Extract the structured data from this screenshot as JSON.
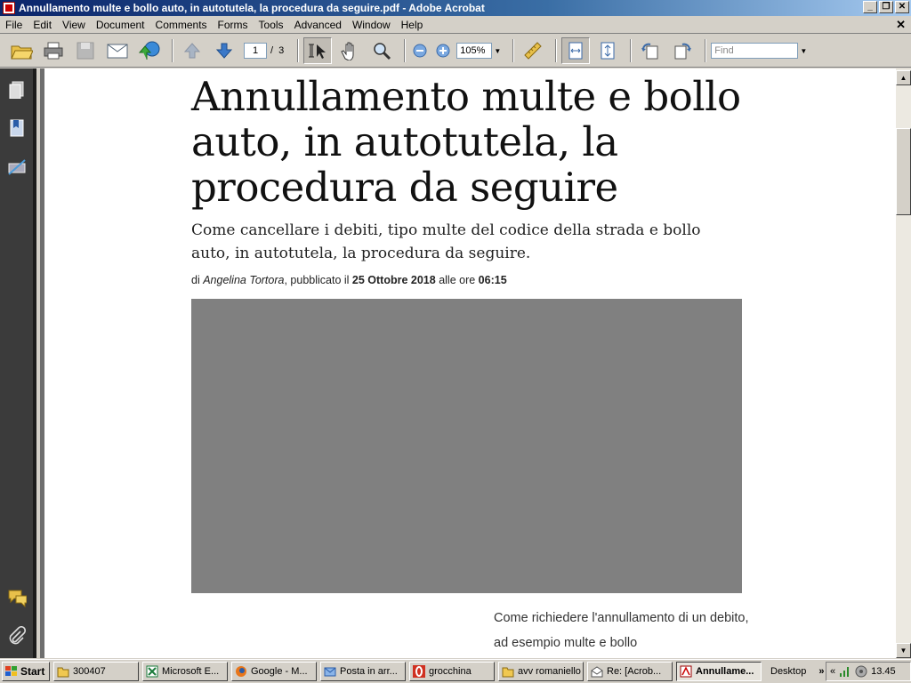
{
  "window": {
    "title": "Annullamento multe e bollo auto, in autotutela, la procedura da seguire.pdf - Adobe Acrobat",
    "buttons": [
      "_",
      "❐",
      "✕"
    ]
  },
  "menubar": {
    "items": [
      "File",
      "Edit",
      "View",
      "Document",
      "Comments",
      "Forms",
      "Tools",
      "Advanced",
      "Window",
      "Help"
    ],
    "close": "✕"
  },
  "toolbar": {
    "page_current": "1",
    "page_total": "/  3",
    "zoom": "105%",
    "find_placeholder": "Find",
    "icons": [
      "open-icon",
      "print-icon",
      "save-icon",
      "email-icon",
      "organizer-icon",
      "previous-page-icon",
      "next-page-icon",
      "select-tool-icon",
      "hand-tool-icon",
      "zoom-tool-icon",
      "zoom-out-icon",
      "zoom-in-icon",
      "measure-icon",
      "fit-width-icon",
      "fit-page-icon",
      "rotate-left-icon",
      "rotate-right-icon"
    ]
  },
  "navpane": {
    "icons": [
      "pages-icon",
      "bookmarks-icon",
      "signatures-icon",
      "comments-icon",
      "attachments-icon"
    ]
  },
  "document": {
    "headline": "Annullamento multe e bollo auto, in autotutela, la procedura da seguire",
    "subtitle": "Come cancellare i debiti, tipo multe del codice della strada e bollo auto, in autotutela, la procedura da seguire.",
    "byline_prefix": "di ",
    "author": "Angelina Tortora",
    "byline_mid": ", pubblicato il ",
    "date": "25 Ottobre 2018",
    "byline_time_prefix": " alle ore ",
    "time": "06:15",
    "body_excerpt": "Come richiedere l'annullamento di un debito, ad esempio multe e bollo"
  },
  "taskbar": {
    "start": "Start",
    "tasks": [
      {
        "label": "300407",
        "icon": "folder-icon"
      },
      {
        "label": "Microsoft E...",
        "icon": "excel-icon"
      },
      {
        "label": "Google - M...",
        "icon": "firefox-icon"
      },
      {
        "label": "Posta in arr...",
        "icon": "mail-icon"
      },
      {
        "label": "grocchina",
        "icon": "opera-icon"
      },
      {
        "label": "avv romaniello",
        "icon": "folder-icon"
      },
      {
        "label": "Re: [Acrob...",
        "icon": "mail-open-icon"
      },
      {
        "label": "Annullame...",
        "icon": "acrobat-icon",
        "active": true
      }
    ],
    "desktop": "Desktop",
    "chevron": "»",
    "tray_arrows": "«",
    "clock": "13.45"
  },
  "colors": {
    "titlebar_start": "#0a246a",
    "titlebar_end": "#a6caf0",
    "navpane": "#3b3b3b",
    "hero_placeholder": "#808080"
  }
}
